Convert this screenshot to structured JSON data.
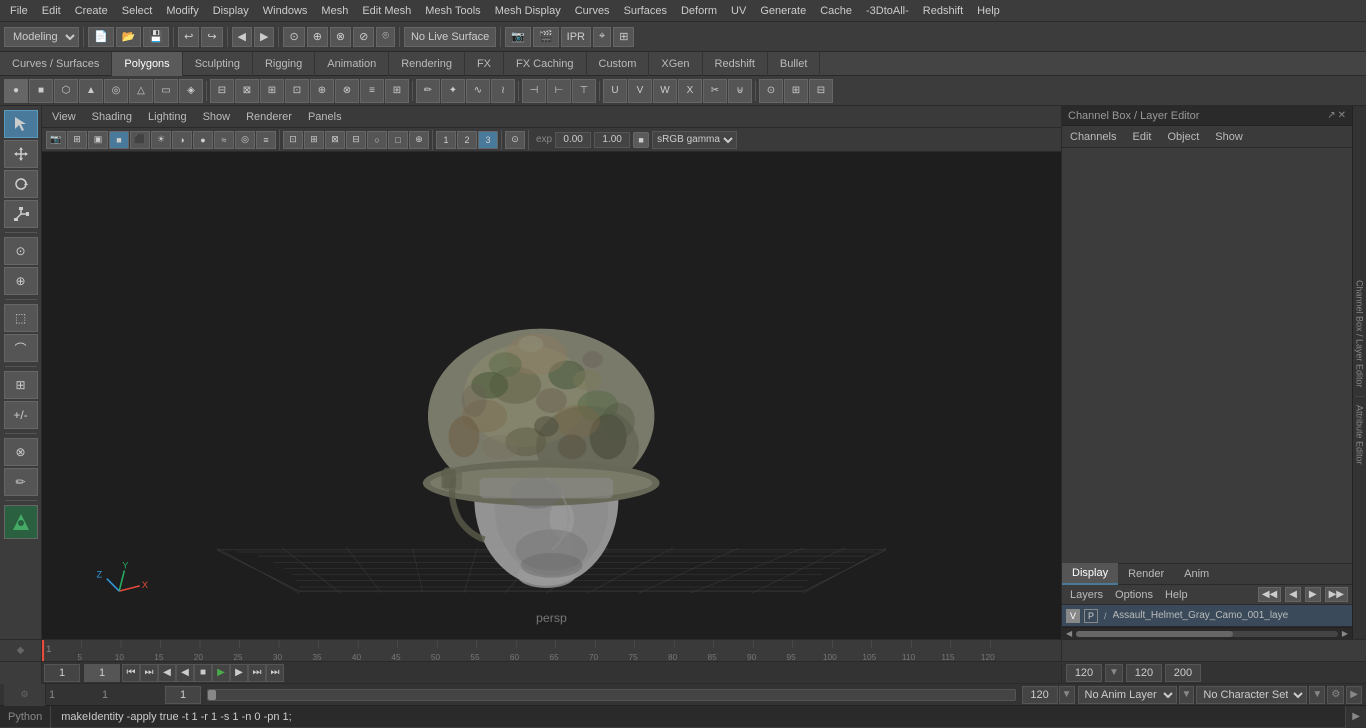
{
  "menubar": {
    "items": [
      "File",
      "Edit",
      "Create",
      "Select",
      "Modify",
      "Display",
      "Windows",
      "Mesh",
      "Edit Mesh",
      "Mesh Tools",
      "Mesh Display",
      "Curves",
      "Surfaces",
      "Deform",
      "UV",
      "Generate",
      "Cache",
      "-3DtoAll-",
      "Redshift",
      "Help"
    ]
  },
  "toolbar1": {
    "mode_label": "Modeling",
    "live_surface": "No Live Surface",
    "icons": [
      "📁",
      "💾",
      "↩",
      "↪",
      "◀",
      "▶",
      "⚙"
    ]
  },
  "tabs": {
    "items": [
      "Curves / Surfaces",
      "Polygons",
      "Sculpting",
      "Rigging",
      "Animation",
      "Rendering",
      "FX",
      "FX Caching",
      "Custom",
      "XGen",
      "Redshift",
      "Bullet"
    ],
    "active": "Polygons"
  },
  "viewport": {
    "menus": [
      "View",
      "Shading",
      "Lighting",
      "Show",
      "Renderer",
      "Panels"
    ],
    "persp_label": "persp",
    "gamma": "sRGB gamma",
    "gamma_value": "sRGB gamma",
    "val1": "0.00",
    "val2": "1.00"
  },
  "right_panel": {
    "title": "Channel Box / Layer Editor",
    "channel_tabs": [
      "Channels",
      "Edit",
      "Object",
      "Show"
    ],
    "layer_tabs": [
      "Display",
      "Render",
      "Anim"
    ],
    "active_layer_tab": "Display",
    "layer_options": [
      "Layers",
      "Options",
      "Help"
    ],
    "layer": {
      "v": "V",
      "p": "P",
      "name": "Assault_Helmet_Gray_Camo_001_laye"
    }
  },
  "timeline": {
    "frame_start": "1",
    "frame_curr": "1",
    "frame_val2": "1",
    "frame_end": "120",
    "frame_max": "120",
    "frame_total": "200",
    "ticks": [
      1,
      5,
      10,
      15,
      20,
      25,
      30,
      35,
      40,
      45,
      50,
      55,
      60,
      65,
      70,
      75,
      80,
      85,
      90,
      95,
      100,
      105,
      110,
      115,
      120
    ]
  },
  "statusbar": {
    "frame_start": "1",
    "frame_curr": "1",
    "frame_val": "1",
    "anim_layer": "No Anim Layer",
    "char_set": "No Character Set",
    "frame_end": "120",
    "frame_total": "200"
  },
  "bottombar": {
    "python_label": "Python",
    "command": "makeIdentity -apply true -t 1 -r 1 -s 1 -n 0 -pn 1;"
  },
  "icons": {
    "play": "▶",
    "prev": "◀",
    "next": "▶",
    "first": "⏮",
    "last": "⏭",
    "stop": "⏹"
  }
}
